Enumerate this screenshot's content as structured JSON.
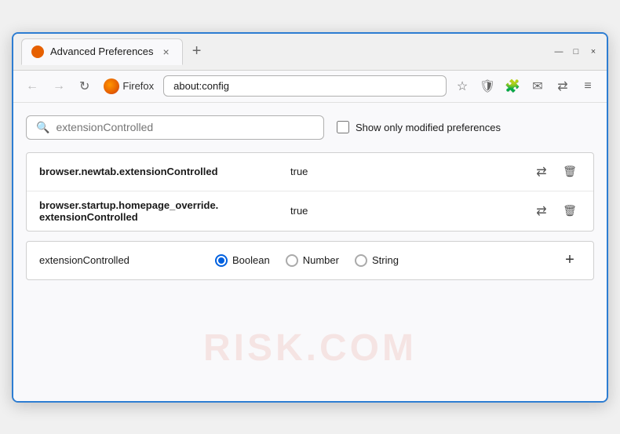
{
  "window": {
    "title": "Advanced Preferences",
    "tab_close": "×",
    "tab_new": "+",
    "win_minimize": "—",
    "win_maximize": "□",
    "win_close": "×"
  },
  "navbar": {
    "back": "←",
    "forward": "→",
    "reload": "↻",
    "browser_name": "Firefox",
    "address": "about:config",
    "bookmark_icon": "☆",
    "shield_icon": "🛡",
    "extension_icon": "🧩",
    "mail_icon": "✉",
    "sync_icon": "⇄",
    "menu_icon": "≡"
  },
  "search": {
    "placeholder": "extensionControlled",
    "value": "extensionControlled",
    "modified_label": "Show only modified preferences"
  },
  "results": [
    {
      "name": "browser.newtab.extensionControlled",
      "value": "true"
    },
    {
      "name": "browser.startup.homepage_override.\nextensionControlled",
      "name_line1": "browser.startup.homepage_override.",
      "name_line2": "extensionControlled",
      "value": "true",
      "multiline": true
    }
  ],
  "new_pref": {
    "name": "extensionControlled",
    "types": [
      {
        "label": "Boolean",
        "selected": true
      },
      {
        "label": "Number",
        "selected": false
      },
      {
        "label": "String",
        "selected": false
      }
    ],
    "add_label": "+"
  },
  "watermark": "RISK.COM",
  "colors": {
    "accent": "#2d7dd2",
    "radio_selected": "#0060df"
  }
}
